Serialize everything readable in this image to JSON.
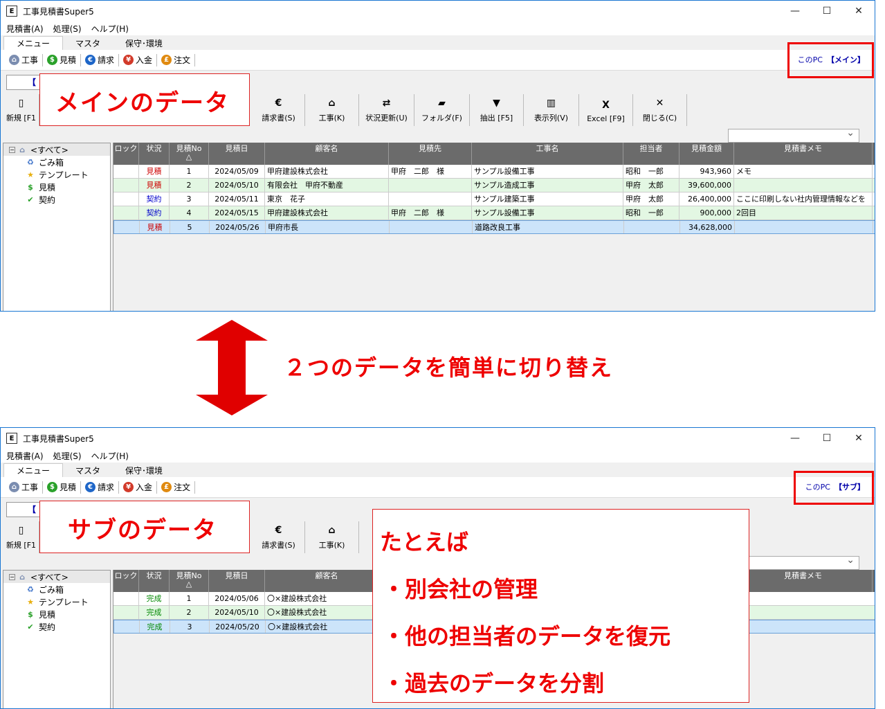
{
  "app": {
    "title": "工事見積書Super5",
    "icon_glyph": "E",
    "controls": [
      "—",
      "☐",
      "✕"
    ]
  },
  "menu": [
    "見積書(A)",
    "処理(S)",
    "ヘルプ(H)"
  ],
  "tabs": [
    "メニュー",
    "マスタ",
    "保守･環境"
  ],
  "ribbon": [
    {
      "label": "工事",
      "icon": "house-icon",
      "color": "#7b8db0",
      "glyph": "⌂"
    },
    {
      "label": "見積",
      "icon": "dollar-icon",
      "color": "#2aa12a",
      "glyph": "$"
    },
    {
      "label": "請求",
      "icon": "euro-icon",
      "color": "#1e66c8",
      "glyph": "€"
    },
    {
      "label": "入金",
      "icon": "yen-icon",
      "color": "#d23a2a",
      "glyph": "¥"
    },
    {
      "label": "注文",
      "icon": "pound-icon",
      "color": "#e08a10",
      "glyph": "£"
    }
  ],
  "top": {
    "pc_prefix": "このPC",
    "pc_name": "【メイン】",
    "search_value": "【",
    "callout": "メインのデータ",
    "toolbar": [
      {
        "label": "新規 [F1",
        "icon": "new-doc-icon",
        "glyph": "▯"
      },
      {
        "label": "請求書(S)",
        "icon": "euro-icon",
        "glyph": "€"
      },
      {
        "label": "工事(K)",
        "icon": "house-icon",
        "glyph": "⌂"
      },
      {
        "label": "状況更新(U)",
        "icon": "refresh-icon",
        "glyph": "⇄"
      },
      {
        "label": "フォルダ(F)",
        "icon": "folder-icon",
        "glyph": "▰"
      },
      {
        "label": "抽出 [F5]",
        "icon": "filter-icon",
        "glyph": "▼"
      },
      {
        "label": "表示列(V)",
        "icon": "columns-icon",
        "glyph": "▥"
      },
      {
        "label": "Excel [F9]",
        "icon": "excel-icon",
        "glyph": "X"
      },
      {
        "label": "閉じる(C)",
        "icon": "close-icon",
        "glyph": "✕"
      }
    ],
    "rows": [
      {
        "lock": "",
        "status": "見積",
        "status_type": "est",
        "no": "1",
        "date": "2024/05/09",
        "customer": "甲府建設株式会社",
        "dest": "甲府　二郎　様",
        "project": "サンプル設備工事",
        "person": "昭和　一郎",
        "amount": "943,960",
        "memo": "メモ"
      },
      {
        "lock": "",
        "status": "見積",
        "status_type": "est",
        "no": "2",
        "date": "2024/05/10",
        "customer": "有限会社　甲府不動産",
        "dest": "",
        "project": "サンプル造成工事",
        "person": "甲府　太郎",
        "amount": "39,600,000",
        "memo": ""
      },
      {
        "lock": "",
        "status": "契約",
        "status_type": "con",
        "no": "3",
        "date": "2024/05/11",
        "customer": "東京　花子",
        "dest": "",
        "project": "サンプル建築工事",
        "person": "甲府　太郎",
        "amount": "26,400,000",
        "memo": "ここに印刷しない社内管理情報などを"
      },
      {
        "lock": "",
        "status": "契約",
        "status_type": "con",
        "no": "4",
        "date": "2024/05/15",
        "customer": "甲府建設株式会社",
        "dest": "甲府　二郎　様",
        "project": "サンプル設備工事",
        "person": "昭和　一郎",
        "amount": "900,000",
        "memo": "2回目"
      },
      {
        "lock": "",
        "status": "見積",
        "status_type": "est",
        "no": "5",
        "date": "2024/05/26",
        "customer": "甲府市長",
        "dest": "",
        "project": "道路改良工事",
        "person": "",
        "amount": "34,628,000",
        "memo": ""
      }
    ]
  },
  "bottom": {
    "pc_prefix": "このPC",
    "pc_name": "【サブ】",
    "search_value": "【",
    "callout": "サブのデータ",
    "toolbar": [
      {
        "label": "新規 [F1",
        "icon": "new-doc-icon",
        "glyph": "▯"
      },
      {
        "label": "請求書(S)",
        "icon": "euro-icon",
        "glyph": "€"
      },
      {
        "label": "工事(K)",
        "icon": "house-icon",
        "glyph": "⌂"
      },
      {
        "label": "状",
        "icon": "refresh-icon",
        "glyph": ""
      }
    ],
    "rows": [
      {
        "lock": "",
        "status": "完成",
        "status_type": "done",
        "no": "1",
        "date": "2024/05/06",
        "customer": "〇×建設株式会社"
      },
      {
        "lock": "",
        "status": "完成",
        "status_type": "done",
        "no": "2",
        "date": "2024/05/10",
        "customer": "〇×建設株式会社"
      },
      {
        "lock": "",
        "status": "完成",
        "status_type": "done",
        "no": "3",
        "date": "2024/05/20",
        "customer": "〇×建設株式会社"
      }
    ]
  },
  "tree": [
    {
      "label": "<すべて>",
      "icon": "house-icon",
      "glyph": "⌂",
      "color": "#7b8db0"
    },
    {
      "label": "ごみ箱",
      "icon": "recycle-icon",
      "glyph": "♻",
      "color": "#3a70c8"
    },
    {
      "label": "テンプレート",
      "icon": "star-icon",
      "glyph": "★",
      "color": "#e8b010"
    },
    {
      "label": "見積",
      "icon": "dollar-icon",
      "glyph": "$",
      "color": "#2aa12a"
    },
    {
      "label": "契約",
      "icon": "check-icon",
      "glyph": "✔",
      "color": "#2aa12a"
    }
  ],
  "columns": [
    {
      "label": "ロック",
      "w": 37
    },
    {
      "label": "状況",
      "w": 44
    },
    {
      "label": "見積No",
      "sub": "△",
      "w": 57
    },
    {
      "label": "見積日",
      "w": 81
    },
    {
      "label": "顧客名",
      "w": 179
    },
    {
      "label": "見積先",
      "w": 120
    },
    {
      "label": "工事名",
      "w": 219
    },
    {
      "label": "担当者",
      "w": 81
    },
    {
      "label": "見積金額",
      "w": 79
    },
    {
      "label": "見積書メモ",
      "w": 200
    }
  ],
  "middle": {
    "text": "２つのデータを簡単に切り替え",
    "arrow_color": "#e00000"
  },
  "examples": {
    "heading": "たとえば",
    "items": [
      "・別会社の管理",
      "・他の担当者のデータを復元",
      "・過去のデータを分割"
    ]
  }
}
